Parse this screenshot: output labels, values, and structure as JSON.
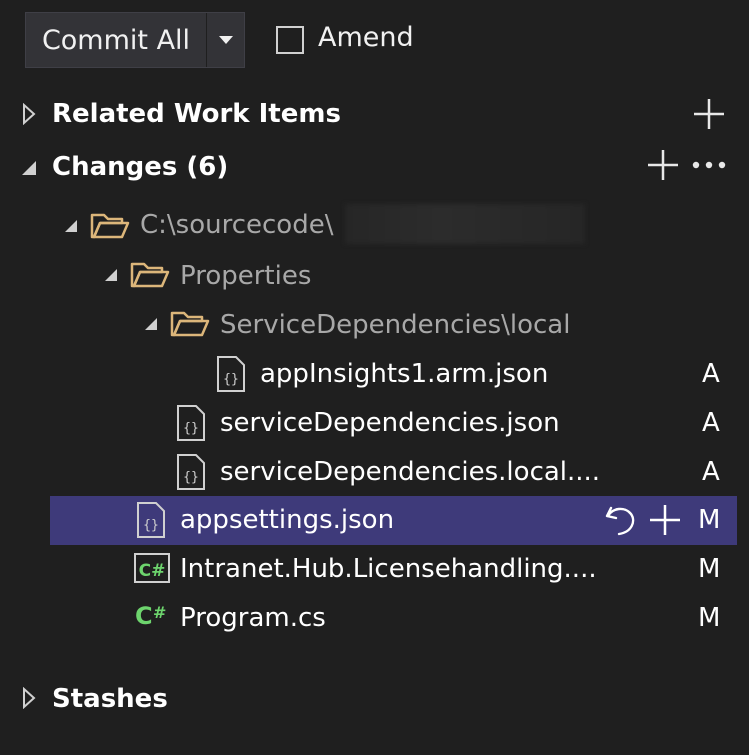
{
  "toolbar": {
    "commit_label": "Commit All",
    "amend_label": "Amend",
    "amend_checked": false
  },
  "sections": {
    "related_work_items": "Related Work Items",
    "changes": "Changes (6)",
    "stashes": "Stashes"
  },
  "tree": {
    "root_folder": "C:\\sourcecode\\",
    "properties_folder": "Properties",
    "servicedeps_folder": "ServiceDependencies\\local",
    "files": [
      {
        "name": "appInsights1.arm.json",
        "status": "A",
        "icon": "json-file-icon"
      },
      {
        "name": "serviceDependencies.json",
        "status": "A",
        "icon": "json-file-icon"
      },
      {
        "name": "serviceDependencies.local....",
        "status": "A",
        "icon": "json-file-icon"
      },
      {
        "name": "appsettings.json",
        "status": "M",
        "icon": "json-file-icon"
      },
      {
        "name": "Intranet.Hub.Licensehandling....",
        "status": "M",
        "icon": "csharp-project-icon"
      },
      {
        "name": "Program.cs",
        "status": "M",
        "icon": "csharp-file-icon"
      }
    ]
  },
  "colors": {
    "background": "#1f1f1f",
    "selection": "#3e3a7a",
    "folder": "#dcb67a",
    "csharp": "#6dd46d"
  }
}
